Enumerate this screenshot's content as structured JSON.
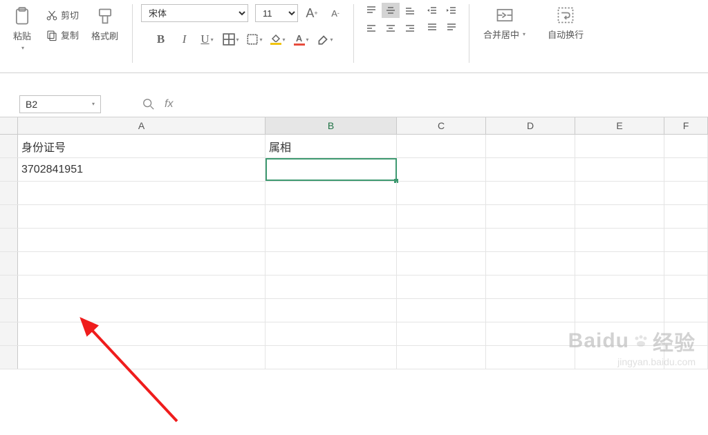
{
  "ribbon": {
    "paste": {
      "label": "粘贴"
    },
    "cut": {
      "label": "剪切"
    },
    "copy": {
      "label": "复制"
    },
    "formatPainter": {
      "label": "格式刷"
    },
    "font": {
      "name": "宋体",
      "size": "11",
      "bold": "B",
      "italic": "I",
      "underline": "U"
    },
    "mergeCells": {
      "label": "合并居中"
    },
    "wrapText": {
      "label": "自动换行"
    }
  },
  "nameBox": {
    "value": "B2"
  },
  "formulaBar": {
    "value": ""
  },
  "columns": [
    "A",
    "B",
    "C",
    "D",
    "E",
    "F"
  ],
  "cells": {
    "A1": "身份证号",
    "B1": "属相",
    "A2": "3702841951",
    "B2": ""
  },
  "selectedCell": "B2",
  "watermark": {
    "brand": "Baidu",
    "subbrand": "经验",
    "url": "jingyan.baidu.com"
  },
  "colors": {
    "fontColor": "#e74c3c",
    "fillColor": "#f1c40f",
    "selection": "#3d9970"
  }
}
